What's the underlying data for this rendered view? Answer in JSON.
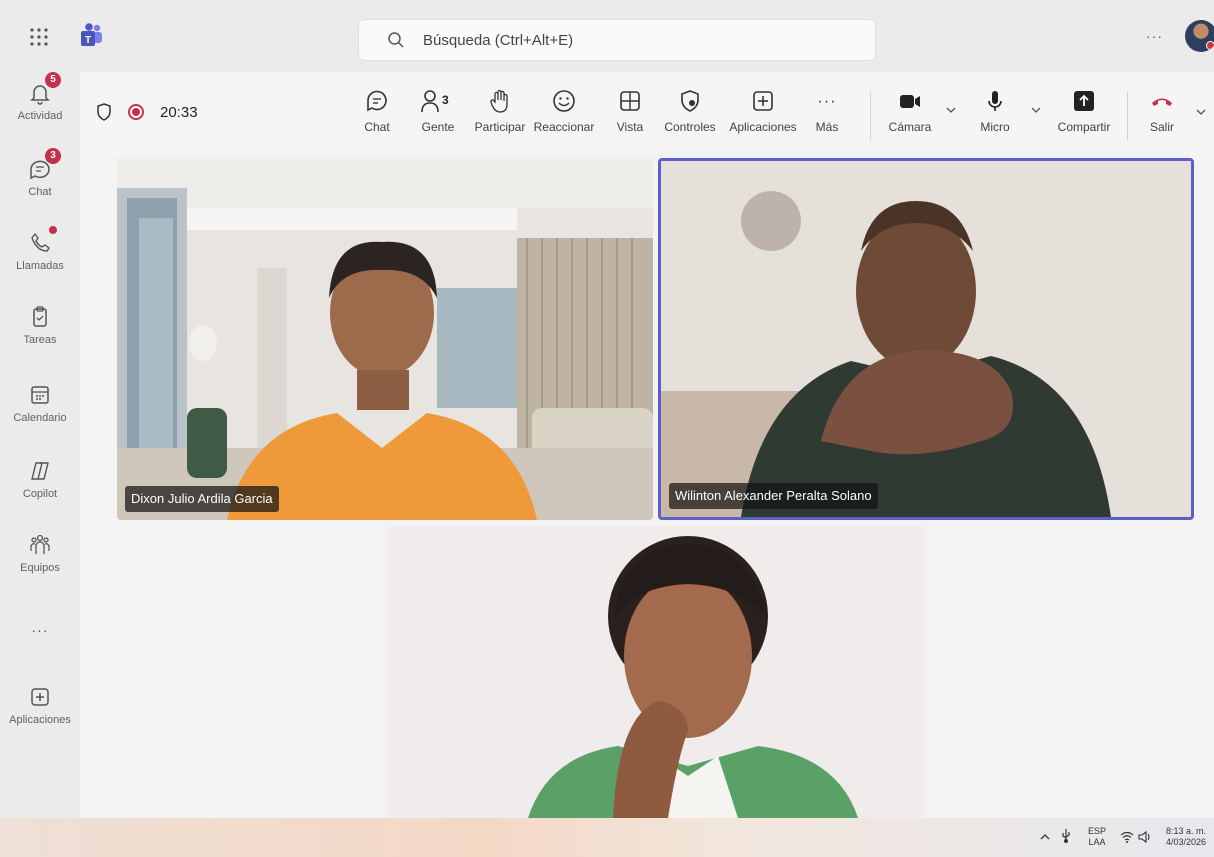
{
  "topbar": {
    "search_placeholder": "Búsqueda (Ctrl+Alt+E)",
    "more_label": "···"
  },
  "rail": {
    "items": [
      {
        "label": "Actividad",
        "badge": "5"
      },
      {
        "label": "Chat",
        "badge": "3"
      },
      {
        "label": "Llamadas"
      },
      {
        "label": "Tareas"
      },
      {
        "label": "Calendario"
      },
      {
        "label": "Copilot"
      },
      {
        "label": "Equipos"
      },
      {
        "label": "Aplicaciones"
      }
    ],
    "more_label": "···"
  },
  "meeting": {
    "timer": "20:33",
    "people_count": "3",
    "toolbar": {
      "chat": "Chat",
      "people": "Gente",
      "raise": "Participar",
      "react": "Reaccionar",
      "view": "Vista",
      "controls": "Controles",
      "apps": "Aplicaciones",
      "more": "Más",
      "more_glyph": "···",
      "camera": "Cámara",
      "mic": "Micro",
      "share": "Compartir",
      "leave": "Salir"
    }
  },
  "participants": [
    {
      "name": "Dixon Julio Ardila Garcia"
    },
    {
      "name": "Wilinton Alexander Peralta Solano"
    },
    {
      "name": ""
    }
  ],
  "taskbar": {
    "lang_top": "ESP",
    "lang_bottom": "LAA",
    "time": "8:13 a. m.",
    "date": "4/03/2026"
  },
  "colors": {
    "accent": "#5b5fc7",
    "badge": "#c4314b",
    "leave": "#c4314b"
  }
}
